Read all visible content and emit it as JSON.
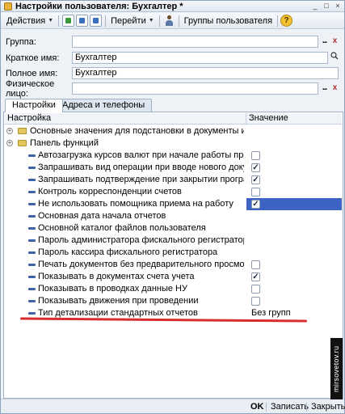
{
  "window": {
    "title": "Настройки пользователя: Бухгалтер *",
    "buttons": {
      "minimize": "_",
      "maximize": "□",
      "close": "×"
    }
  },
  "toolbar": {
    "actions_label": "Действия",
    "goto_label": "Перейти",
    "user_groups_label": "Группы пользователя",
    "help_label": "?"
  },
  "form": {
    "group": {
      "label": "Группа:",
      "value": ""
    },
    "short_name": {
      "label": "Краткое имя:",
      "value": "Бухгалтер"
    },
    "full_name": {
      "label": "Полное имя:",
      "value": "Бухгалтер"
    },
    "person": {
      "label": "Физическое лицо:",
      "value": ""
    },
    "dots": "...",
    "clear": "x",
    "search": "q"
  },
  "tabs": [
    {
      "label": "Настройки",
      "active": true
    },
    {
      "label": "Адреса и телефоны",
      "active": false
    }
  ],
  "table": {
    "headers": {
      "setting": "Настройка",
      "value": "Значение"
    },
    "rows": [
      {
        "label": "Основные значения для подстановки в документы и справо...",
        "kind": "group",
        "value": ""
      },
      {
        "label": "Панель функций",
        "kind": "group",
        "value": ""
      },
      {
        "label": "Автозагрузка курсов валют при начале работы программы",
        "kind": "check",
        "checked": false
      },
      {
        "label": "Запрашивать вид операции при вводе нового документа",
        "kind": "check",
        "checked": true
      },
      {
        "label": "Запрашивать подтверждение при закрытии программы",
        "kind": "check",
        "checked": true
      },
      {
        "label": "Контроль корреспонденции счетов",
        "kind": "check",
        "checked": false
      },
      {
        "label": "Не использовать помощника приема на работу",
        "kind": "check",
        "checked": true,
        "selected": true
      },
      {
        "label": "Основная дата начала отчетов",
        "kind": "text",
        "value": ""
      },
      {
        "label": "Основной каталог файлов пользователя",
        "kind": "text",
        "value": ""
      },
      {
        "label": "Пароль администратора фискального регистратора",
        "kind": "text",
        "value": ""
      },
      {
        "label": "Пароль кассира фискального регистратора",
        "kind": "text",
        "value": ""
      },
      {
        "label": "Печать документов без предварительного просмотра",
        "kind": "check",
        "checked": false
      },
      {
        "label": "Показывать в документах счета учета",
        "kind": "check",
        "checked": true
      },
      {
        "label": "Показывать в проводках данные НУ",
        "kind": "check",
        "checked": false
      },
      {
        "label": "Показывать движения при проведении",
        "kind": "check",
        "checked": false
      },
      {
        "label": "Тип детализации стандартных отчетов",
        "kind": "text",
        "value": "Без групп"
      }
    ],
    "check_mark": "✓",
    "expand_mark": "+"
  },
  "footer": {
    "ok_label": "OK",
    "save_label": "Записать",
    "close_label": "Закрыть"
  },
  "watermark": "mirsovetov.ru",
  "colors": {
    "selection": "#3d63c4",
    "annotation_line": "#d92c2c"
  }
}
